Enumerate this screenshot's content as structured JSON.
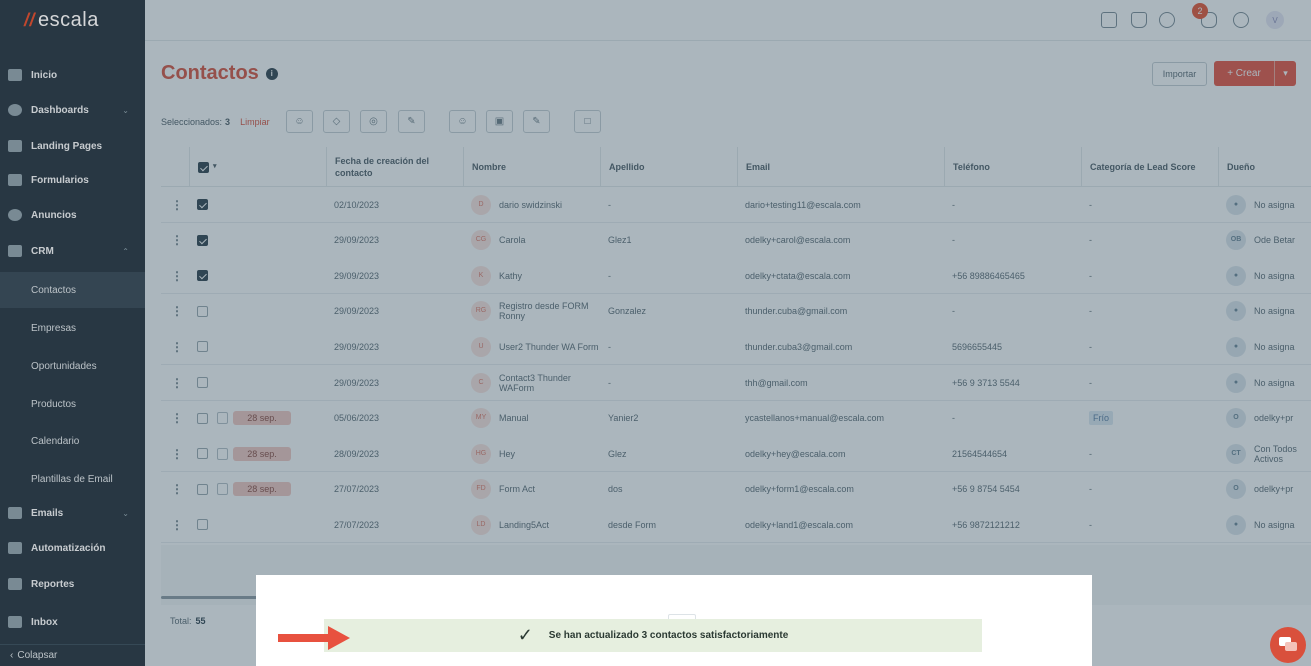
{
  "brand": {
    "logo_text": "escala",
    "logo_mark": "//"
  },
  "sidebar": {
    "items": [
      {
        "label": "Inicio",
        "icon": "home-icon"
      },
      {
        "label": "Dashboards",
        "icon": "pie-chart-icon"
      },
      {
        "label": "Landing Pages",
        "icon": "landing-icon"
      },
      {
        "label": "Formularios",
        "icon": "form-icon"
      },
      {
        "label": "Anuncios",
        "icon": "ads-icon"
      },
      {
        "label": "CRM",
        "icon": "users-icon"
      }
    ],
    "crm_sub": [
      "Contactos",
      "Empresas",
      "Oportunidades",
      "Productos",
      "Calendario",
      "Plantillas de Email"
    ],
    "items_bottom": [
      {
        "label": "Emails",
        "icon": "mail-icon"
      },
      {
        "label": "Automatización",
        "icon": "bolt-icon"
      },
      {
        "label": "Reportes",
        "icon": "report-icon"
      },
      {
        "label": "Inbox",
        "icon": "inbox-icon"
      }
    ],
    "collapse_label": "Colapsar"
  },
  "topbar": {
    "notif_count": "2",
    "avatar_initial": "V"
  },
  "page": {
    "title": "Contactos",
    "import_label": "Importar",
    "create_label": "+ Crear",
    "selected_label": "Seleccionados:",
    "selected_count": "3",
    "clear_label": "Limpiar"
  },
  "table": {
    "headers": {
      "created": "Fecha de creación del contacto",
      "name": "Nombre",
      "last": "Apellido",
      "email": "Email",
      "phone": "Teléfono",
      "lead": "Categoría de Lead Score",
      "owner": "Dueño"
    },
    "rows": [
      {
        "checked": true,
        "badge": "",
        "date": "02/10/2023",
        "initials": "D",
        "name": "dario swidzinski",
        "last": "-",
        "email": "dario+testing11@escala.com",
        "phone": "-",
        "lead": "-",
        "owner_initials": "",
        "owner": "No asigna"
      },
      {
        "checked": true,
        "badge": "",
        "date": "29/09/2023",
        "initials": "CG",
        "name": "Carola",
        "last": "Glez1",
        "email": "odelky+carol@escala.com",
        "phone": "-",
        "lead": "-",
        "owner_initials": "OB",
        "owner": "Ode Betar"
      },
      {
        "checked": true,
        "badge": "",
        "date": "29/09/2023",
        "initials": "K",
        "name": "Kathy",
        "last": "-",
        "email": "odelky+ctata@escala.com",
        "phone": "+56 89886465465",
        "lead": "-",
        "owner_initials": "",
        "owner": "No asigna"
      },
      {
        "checked": false,
        "badge": "",
        "date": "29/09/2023",
        "initials": "RG",
        "name": "Registro desde FORM Ronny",
        "last": "Gonzalez",
        "email": "thunder.cuba@gmail.com",
        "phone": "-",
        "lead": "-",
        "owner_initials": "",
        "owner": "No asigna"
      },
      {
        "checked": false,
        "badge": "",
        "date": "29/09/2023",
        "initials": "U",
        "name": "User2 Thunder WA Form",
        "last": "-",
        "email": "thunder.cuba3@gmail.com",
        "phone": "5696655445",
        "lead": "-",
        "owner_initials": "",
        "owner": "No asigna"
      },
      {
        "checked": false,
        "badge": "",
        "date": "29/09/2023",
        "initials": "C",
        "name": "Contact3 Thunder WAForm",
        "last": "-",
        "email": "thh@gmail.com",
        "phone": "+56 9 3713 5544",
        "lead": "-",
        "owner_initials": "",
        "owner": "No asigna"
      },
      {
        "checked": false,
        "badge": "28 sep.",
        "date": "05/06/2023",
        "initials": "MY",
        "name": "Manual",
        "last": "Yanier2",
        "email": "ycastellanos+manual@escala.com",
        "phone": "-",
        "lead": "Frío",
        "owner_initials": "O",
        "owner": "odelky+pr"
      },
      {
        "checked": false,
        "badge": "28 sep.",
        "date": "28/09/2023",
        "initials": "HG",
        "name": "Hey",
        "last": "Glez",
        "email": "odelky+hey@escala.com",
        "phone": "21564544654",
        "lead": "-",
        "owner_initials": "CT",
        "owner": "Con Todos Activos"
      },
      {
        "checked": false,
        "badge": "28 sep.",
        "date": "27/07/2023",
        "initials": "FD",
        "name": "Form Act",
        "last": "dos",
        "email": "odelky+form1@escala.com",
        "phone": "+56 9 8754 5454",
        "lead": "-",
        "owner_initials": "O",
        "owner": "odelky+pr"
      },
      {
        "checked": false,
        "badge": "",
        "date": "27/07/2023",
        "initials": "LD",
        "name": "Landing5Act",
        "last": "desde Form",
        "email": "odelky+land1@escala.com",
        "phone": "+56 9872121212",
        "lead": "-",
        "owner_initials": "",
        "owner": "No asigna"
      }
    ],
    "total_label": "Total:",
    "total_value": "55"
  },
  "toast": {
    "message": "Se han actualizado 3 contactos satisfactoriamente"
  },
  "colors": {
    "accent": "#e8513f",
    "sidebar": "#2c3e4a",
    "toast_bg": "#e6efdf",
    "arrow": "#e8513f"
  }
}
